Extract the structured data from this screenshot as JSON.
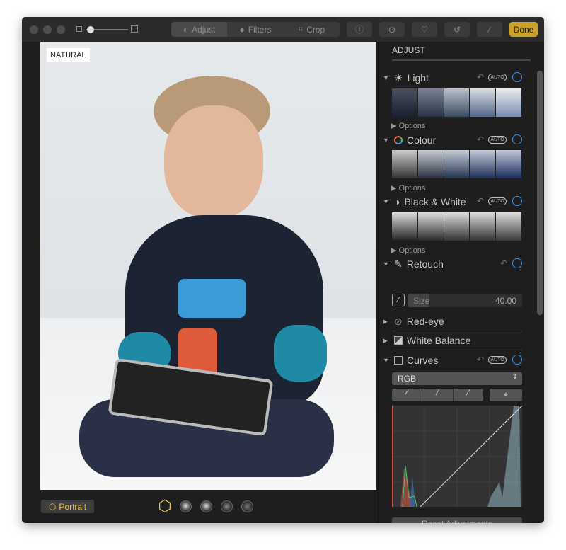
{
  "toolbar": {
    "tabs": [
      {
        "label": "Adjust",
        "icon": "adjust-icon"
      },
      {
        "label": "Filters",
        "icon": "filters-icon"
      },
      {
        "label": "Crop",
        "icon": "crop-icon"
      }
    ],
    "done": "Done",
    "zoom_slider": 0.05,
    "icons": [
      "info-icon",
      "more-icon",
      "heart-icon",
      "rotate-icon",
      "magic-wand-icon"
    ]
  },
  "photo": {
    "badge": "NATURAL"
  },
  "bottom": {
    "portrait": "Portrait",
    "lighting_options": [
      "natural",
      "studio",
      "contour",
      "stage",
      "stage-mono"
    ]
  },
  "sidebar": {
    "title": "ADJUST",
    "auto": "AUTO",
    "options": "Options",
    "sections": {
      "light": "Light",
      "colour": "Colour",
      "bw": "Black & White",
      "retouch": "Retouch",
      "redeye": "Red-eye",
      "wb": "White Balance",
      "curves": "Curves"
    },
    "retouch_size_label": "Size",
    "retouch_size_value": "40.00",
    "curves_channel": "RGB",
    "reset": "Reset Adjustments"
  },
  "colors": {
    "accent": "#3a8ee6",
    "done": "#c9a227",
    "portrait": "#e5c04a"
  }
}
